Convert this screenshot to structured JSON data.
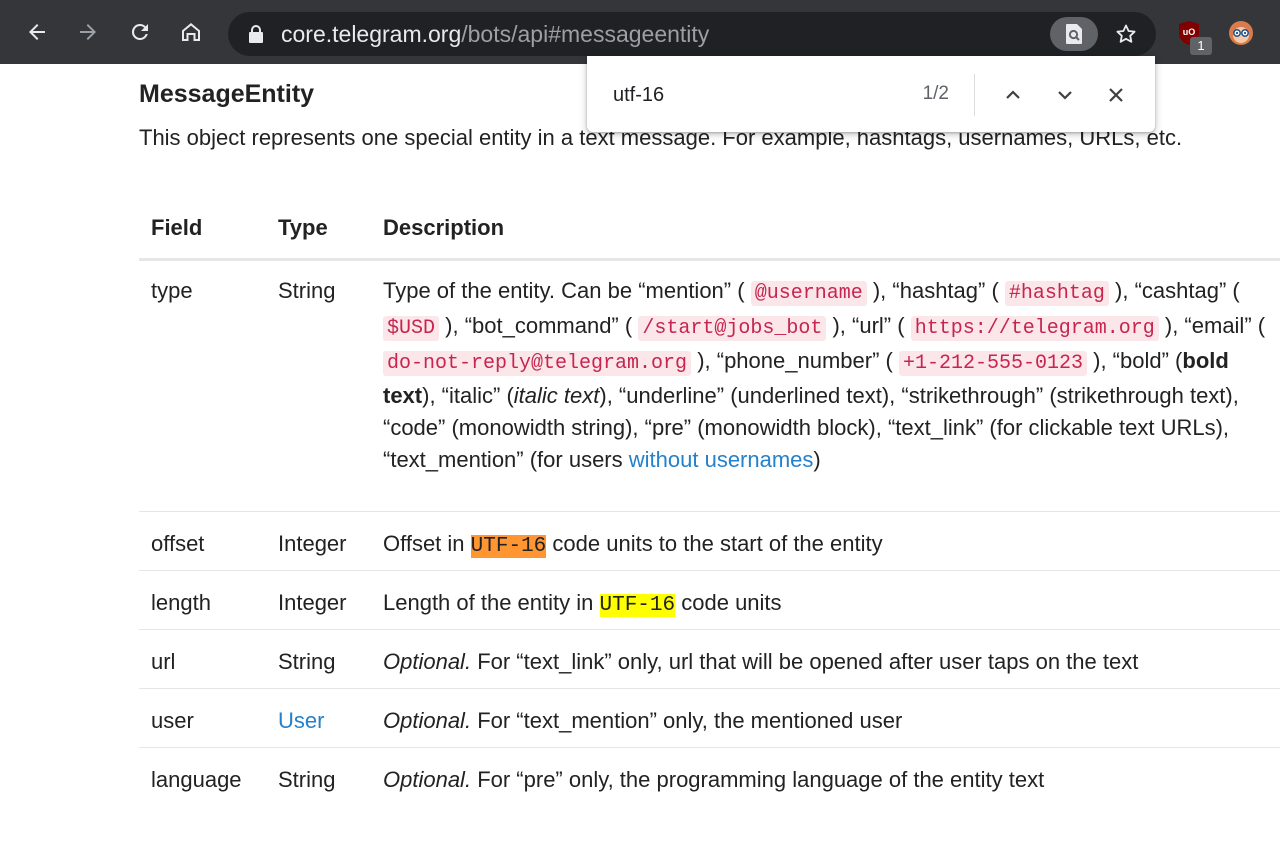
{
  "browser": {
    "url_host": "core.telegram.org",
    "url_path": "/bots/api#messageentity",
    "extension_badge": "1"
  },
  "find": {
    "query": "utf-16",
    "count": "1/2"
  },
  "page": {
    "heading": "MessageEntity",
    "intro": "This object represents one special entity in a text message. For example, hashtags, usernames, URLs, etc.",
    "table": {
      "headers": [
        "Field",
        "Type",
        "Description"
      ],
      "rows": [
        {
          "field": "type",
          "type": "String",
          "d": {
            "p1": "Type of the entity. Can be “mention” (",
            "c1": "@username",
            "p2": "), “hashtag” (",
            "c2": "#hashtag",
            "p3": "), “cashtag” (",
            "c3": "$USD",
            "p4": "), “bot_command” (",
            "c4": "/start@jobs_bot",
            "p5": "), “url” (",
            "c5": "https://telegram.org",
            "p6": "), “email” (",
            "c6": "do-not-reply@telegram.org",
            "p7": "), “phone_number” (",
            "c7": "+1-212-555-0123",
            "p8": "), “bold” (",
            "b1": "bold text",
            "p9": "), “italic” (",
            "i1": "italic text",
            "p10": "), “underline” (underlined text), “strikethrough” (strikethrough text), “code” (monowidth string), “pre” (monowidth block), “text_link” (for clickable text URLs), “text_mention” (for users",
            "link": "without usernames",
            "p11": ")"
          }
        },
        {
          "field": "offset",
          "type": "Integer",
          "pre": "Offset in",
          "hl": "UTF-16",
          "post": "code units to the start of the entity"
        },
        {
          "field": "length",
          "type": "Integer",
          "pre": "Length of the entity in",
          "hl": "UTF-16",
          "post": "code units"
        },
        {
          "field": "url",
          "type": "String",
          "opt": "Optional.",
          "rest": "For “text_link” only, url that will be opened after user taps on the text"
        },
        {
          "field": "user",
          "type": "User",
          "opt": "Optional.",
          "rest": "For “text_mention” only, the mentioned user"
        },
        {
          "field": "language",
          "type": "String",
          "opt": "Optional.",
          "rest": "For “pre” only, the programming language of the entity text"
        }
      ]
    }
  },
  "colors": {
    "toolbar": "#35363a",
    "omnibox": "#202124",
    "link": "#2481cc",
    "code_text": "#c7254e",
    "code_bg": "#fbe7ea",
    "find_active": "#ff9632",
    "find_match": "#ffff00"
  },
  "icons": {
    "back": "arrow-left-icon",
    "forward": "arrow-right-icon",
    "reload": "reload-icon",
    "home": "home-icon",
    "lock": "lock-icon",
    "search_tab": "search-page-icon",
    "bookmark": "star-icon",
    "ublock": "ublock-origin-icon",
    "profile": "profile-avatar-icon",
    "find_prev": "chevron-up-icon",
    "find_next": "chevron-down-icon",
    "find_close": "close-icon"
  }
}
